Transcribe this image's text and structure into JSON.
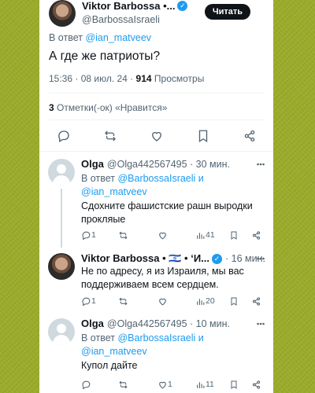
{
  "main_tweet": {
    "author_name": "Viktor Barbossa •...",
    "handle": "@BarbossaIsraeli",
    "follow_label": "Читать",
    "reply_to_prefix": "В ответ",
    "reply_to_handle": "@ian_matveev",
    "text": "А где же патриоты?",
    "time": "15:36 · 08 июл. 24 ·",
    "views_count": "914",
    "views_label": "Просмотры",
    "likes_count": "3",
    "likes_label": "Отметки(-ок) «Нравится»"
  },
  "replies": [
    {
      "author_name": "Olga",
      "handle": "@Olga442567495 · 30 мин.",
      "reply_to_prefix": "В ответ",
      "reply_to_1": "@BarbossaIsraeli",
      "reply_to_and": "и",
      "reply_to_2": "@ian_matveev",
      "text_line1": "Сдохните фашистские рашн выродки",
      "text_line2": "прокляые",
      "reply_count": "1",
      "retweet_count": "",
      "like_count": "",
      "views_count": "41"
    },
    {
      "author_name": "Viktor Barbossa • 🇮🇱 • ‘И...",
      "handle": "· 16 мин.",
      "text_line1": "Не по адресу, я из Израиля, мы вас",
      "text_line2": "поддерживаем всем сердцем.",
      "reply_count": "1",
      "retweet_count": "",
      "like_count": "",
      "views_count": "20"
    },
    {
      "author_name": "Olga",
      "handle": "@Olga442567495 · 10 мин.",
      "reply_to_prefix": "В ответ",
      "reply_to_1": "@BarbossaIsraeli",
      "reply_to_and": "и",
      "reply_to_2": "@ian_matveev",
      "text_line1": "Купол дайте",
      "reply_count": "",
      "retweet_count": "",
      "like_count": "1",
      "views_count": "11"
    }
  ],
  "icons": {
    "reply": "reply-icon",
    "retweet": "retweet-icon",
    "like": "heart-icon",
    "bookmark": "bookmark-icon",
    "share": "share-icon",
    "views": "views-chart-icon",
    "more": "more-icon",
    "verified": "verified-badge-icon"
  },
  "colors": {
    "background": "#9aab2a",
    "accent": "#1d9bf0",
    "text": "#0f1419",
    "muted": "#536471"
  }
}
